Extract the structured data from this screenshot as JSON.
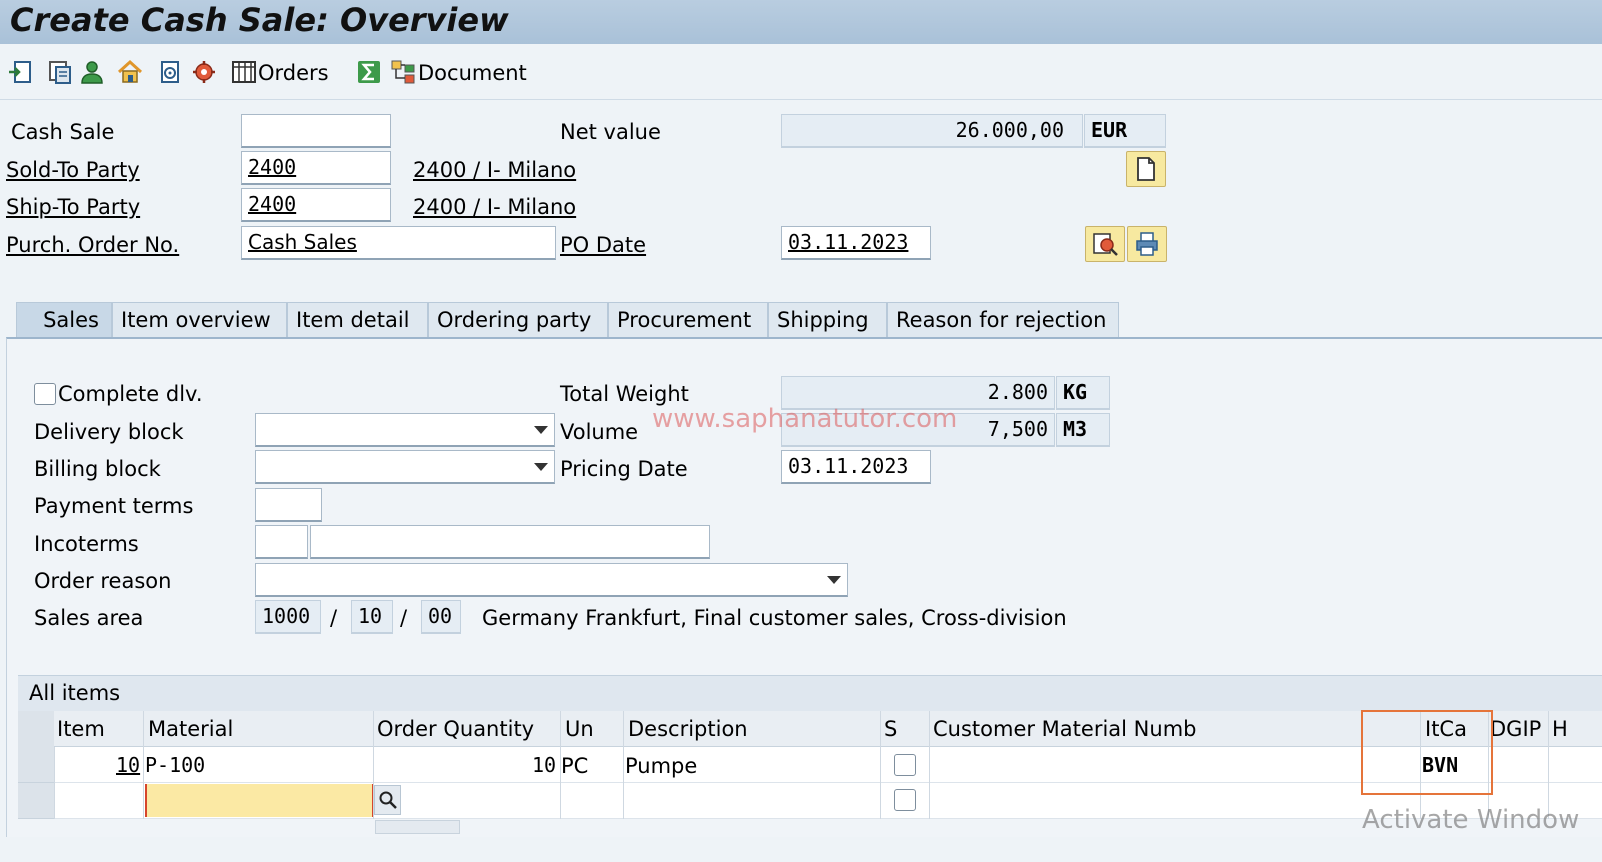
{
  "window": {
    "title": "Create Cash Sale: Overview"
  },
  "toolbar": {
    "icons": [
      "document-header-icon",
      "item-list-icon",
      "partner-icon",
      "home-icon",
      "config-icon",
      "settings-icon"
    ],
    "orders_label": "Orders",
    "document_label": "Document"
  },
  "header": {
    "cash_sale_label": "Cash Sale",
    "cash_sale_value": "",
    "net_value_label": "Net value",
    "net_value": "26.000,00",
    "currency": "EUR",
    "sold_to_label": "Sold-To Party",
    "sold_to_value": "2400",
    "sold_to_desc": "2400 / I- Milano",
    "ship_to_label": "Ship-To Party",
    "ship_to_value": "2400",
    "ship_to_desc": "2400 / I- Milano",
    "po_label": "Purch. Order No.",
    "po_value": "Cash Sales",
    "po_date_label": "PO Date",
    "po_date_value": "03.11.2023"
  },
  "tabs": [
    {
      "label": "Sales",
      "active": true
    },
    {
      "label": "Item overview"
    },
    {
      "label": "Item detail"
    },
    {
      "label": "Ordering party"
    },
    {
      "label": "Procurement"
    },
    {
      "label": "Shipping"
    },
    {
      "label": "Reason for rejection"
    }
  ],
  "sales": {
    "complete_dlv_label": "Complete dlv.",
    "total_weight_label": "Total Weight",
    "total_weight_value": "2.800",
    "weight_unit": "KG",
    "delivery_block_label": "Delivery block",
    "volume_label": "Volume",
    "volume_value": "7,500",
    "volume_unit": "M3",
    "billing_block_label": "Billing block",
    "pricing_date_label": "Pricing Date",
    "pricing_date_value": "03.11.2023",
    "payment_terms_label": "Payment terms",
    "incoterms_label": "Incoterms",
    "order_reason_label": "Order reason",
    "sales_area_label": "Sales area",
    "sales_org": "1000",
    "distr_channel": "10",
    "division": "00",
    "slash": "/",
    "sales_area_desc": "Germany Frankfurt, Final customer sales, Cross-division"
  },
  "items_grid": {
    "title": "All items",
    "columns": [
      "Item",
      "Material",
      "Order Quantity",
      "Un",
      "Description",
      "S",
      "Customer Material Numb",
      "ItCa",
      "DGIP",
      "H"
    ],
    "rows": [
      {
        "item": "10",
        "material": "P-100",
        "quantity": "10",
        "unit": "PC",
        "description": "Pumpe",
        "itca": "BVN"
      }
    ]
  },
  "overlay": {
    "watermark": "www.saphanatutor.com",
    "activate_windows": "Activate Window"
  }
}
